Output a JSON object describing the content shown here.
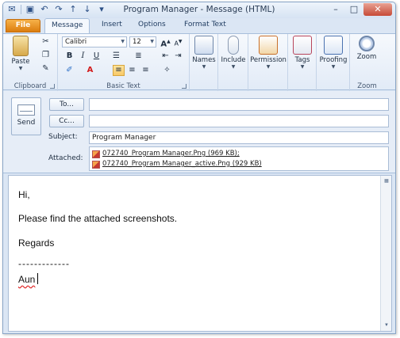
{
  "window": {
    "title": "Program Manager - Message (HTML)"
  },
  "tabs": {
    "file": "File",
    "message": "Message",
    "insert": "Insert",
    "options": "Options",
    "format_text": "Format Text"
  },
  "ribbon": {
    "clipboard": {
      "label": "Clipboard",
      "paste": "Paste"
    },
    "basic_text": {
      "label": "Basic Text",
      "font": "Calibri",
      "size": "12"
    },
    "names": "Names",
    "include": "Include",
    "permission": "Permission",
    "tags": "Tags",
    "proofing": "Proofing",
    "zoom": {
      "button": "Zoom",
      "label": "Zoom"
    }
  },
  "form": {
    "send": "Send",
    "to_button": "To...",
    "cc_button": "Cc...",
    "to_value": "",
    "cc_value": "",
    "subject_label": "Subject:",
    "subject_value": "Program Manager",
    "attached_label": "Attached:",
    "attachments": [
      {
        "name": "072740_Program Manager.Png (969 KB);"
      },
      {
        "name": "072740_Program Manager_active.Png (929 KB)"
      }
    ]
  },
  "message_body": {
    "greeting": "Hi,",
    "line": "Please find the attached screenshots.",
    "closing": "Regards",
    "separator": "-------------",
    "signature": "Aun"
  },
  "colors": {
    "file_tab": "#dc7d0e",
    "ribbon_bg": "#e2ebf7",
    "frame": "#8aa6c8"
  }
}
